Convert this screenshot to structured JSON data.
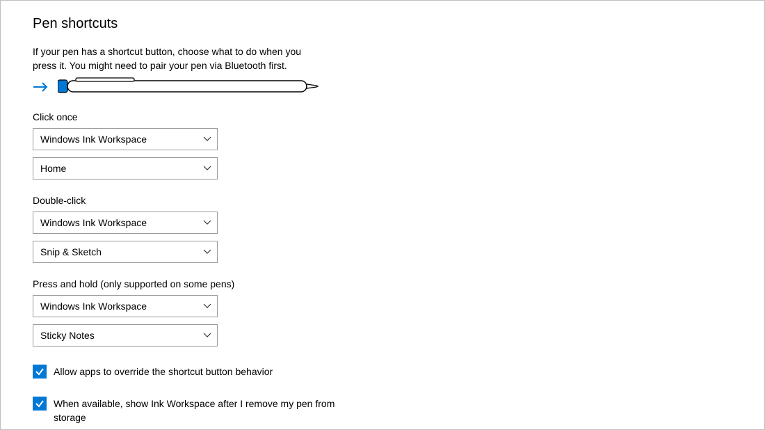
{
  "header": {
    "title": "Pen shortcuts",
    "description": "If your pen has a shortcut button, choose what to do when you press it. You might need to pair your pen via Bluetooth first."
  },
  "groups": {
    "clickOnce": {
      "label": "Click once",
      "primary": "Windows Ink Workspace",
      "secondary": "Home"
    },
    "doubleClick": {
      "label": "Double-click",
      "primary": "Windows Ink Workspace",
      "secondary": "Snip & Sketch"
    },
    "pressHold": {
      "label": "Press and hold (only supported on some pens)",
      "primary": "Windows Ink Workspace",
      "secondary": "Sticky Notes"
    }
  },
  "checkboxes": {
    "allowOverride": "Allow apps to override the shortcut button behavior",
    "showInkWorkspace": "When available, show Ink Workspace after I remove my pen from storage"
  }
}
